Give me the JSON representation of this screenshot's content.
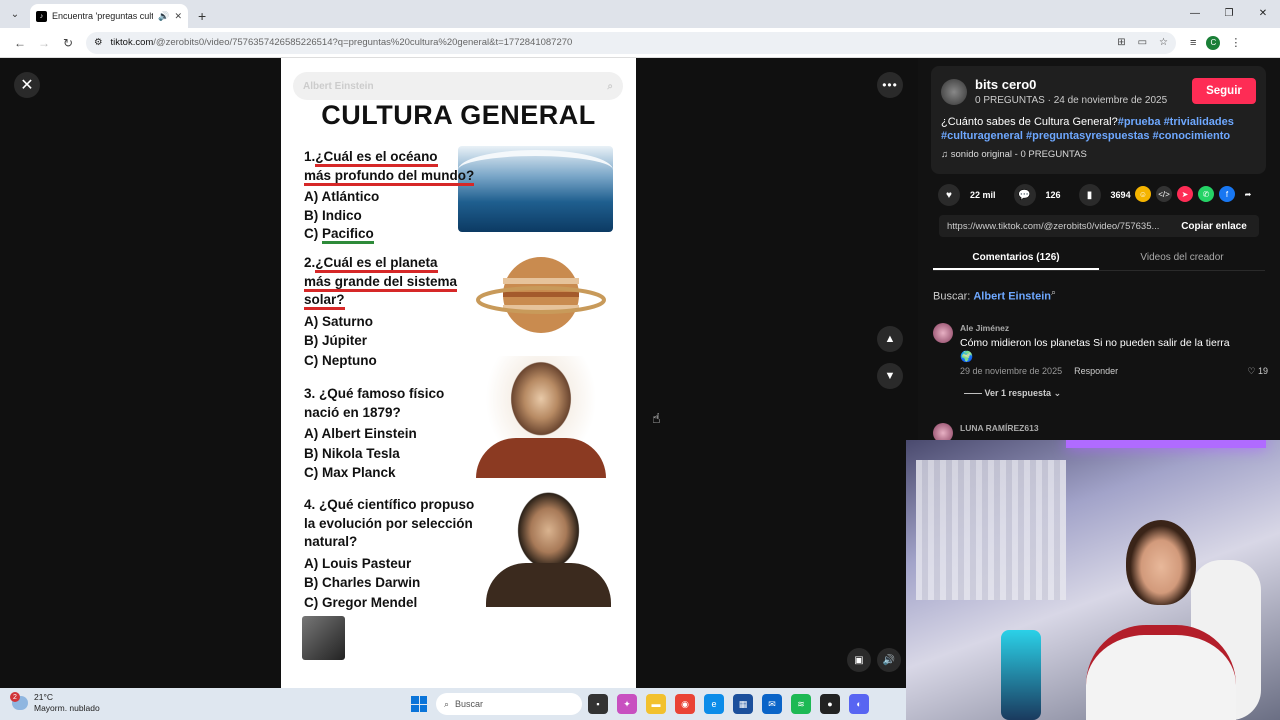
{
  "browser": {
    "tab_title": "Encuentra 'preguntas cultu",
    "url_host": "tiktok.com",
    "url_path": "/@zerobits0/video/7576357426585226514?q=preguntas%20cultura%20general&t=1772841087270"
  },
  "video": {
    "search_overlay": "Albert Einstein",
    "title": "CULTURA GENERAL",
    "questions": [
      {
        "number": "1.",
        "text_lines": [
          "¿Cuál es el océano",
          "más profundo del mundo?"
        ],
        "options": [
          "A) Atlántico",
          "B) Indico",
          "C) Pacifico"
        ]
      },
      {
        "number": "2.",
        "text_lines": [
          "¿Cuál es el planeta",
          "más grande del sistema",
          "solar?"
        ],
        "options": [
          "A) Saturno",
          "B) Júpiter",
          "C) Neptuno"
        ]
      },
      {
        "number": "3.",
        "text_lines": [
          "¿Qué famoso físico",
          "nació en 1879?"
        ],
        "options": [
          "A) Albert Einstein",
          "B) Nikola Tesla",
          "C) Max Planck"
        ]
      },
      {
        "number": "4.",
        "text_lines": [
          "¿Qué científico propuso",
          "la evolución por selección",
          "natural?"
        ],
        "options": [
          "A) Louis Pasteur",
          "B) Charles Darwin",
          "C) Gregor Mendel"
        ]
      }
    ]
  },
  "sidebar": {
    "author_name": "bits cero0",
    "author_sub": "0 PREGUNTAS · 24 de noviembre de 2025",
    "follow_label": "Seguir",
    "desc_text": "¿Cuánto sabes de Cultura General?",
    "tags_line1": "#prueba #trivialidades",
    "tags_line2": "#culturageneral #preguntasyrespuestas #conocimiento",
    "sound": "sonido original - 0 PREGUNTAS",
    "likes": "22 mil",
    "comments": "126",
    "saves": "3694",
    "link": "https://www.tiktok.com/@zerobits0/video/757635...",
    "copy_label": "Copiar enlace",
    "tab_comments": "Comentarios (126)",
    "tab_videos": "Videos del creador",
    "search_prefix": "Buscar:",
    "search_term": "Albert Einstein",
    "comments_list": [
      {
        "name": "Ale Jiménez",
        "text": "Cómo midieron los planetas Si no pueden salir de la tierra",
        "date": "29 de noviembre de 2025",
        "reply": "Responder",
        "likes": "19",
        "replies": "Ver 1 respuesta"
      },
      {
        "name": "LUNA RAMÍREZ613"
      }
    ]
  },
  "taskbar": {
    "badge": "2",
    "temp": "21°C",
    "weather": "Mayorm. nublado",
    "search": "Buscar"
  }
}
